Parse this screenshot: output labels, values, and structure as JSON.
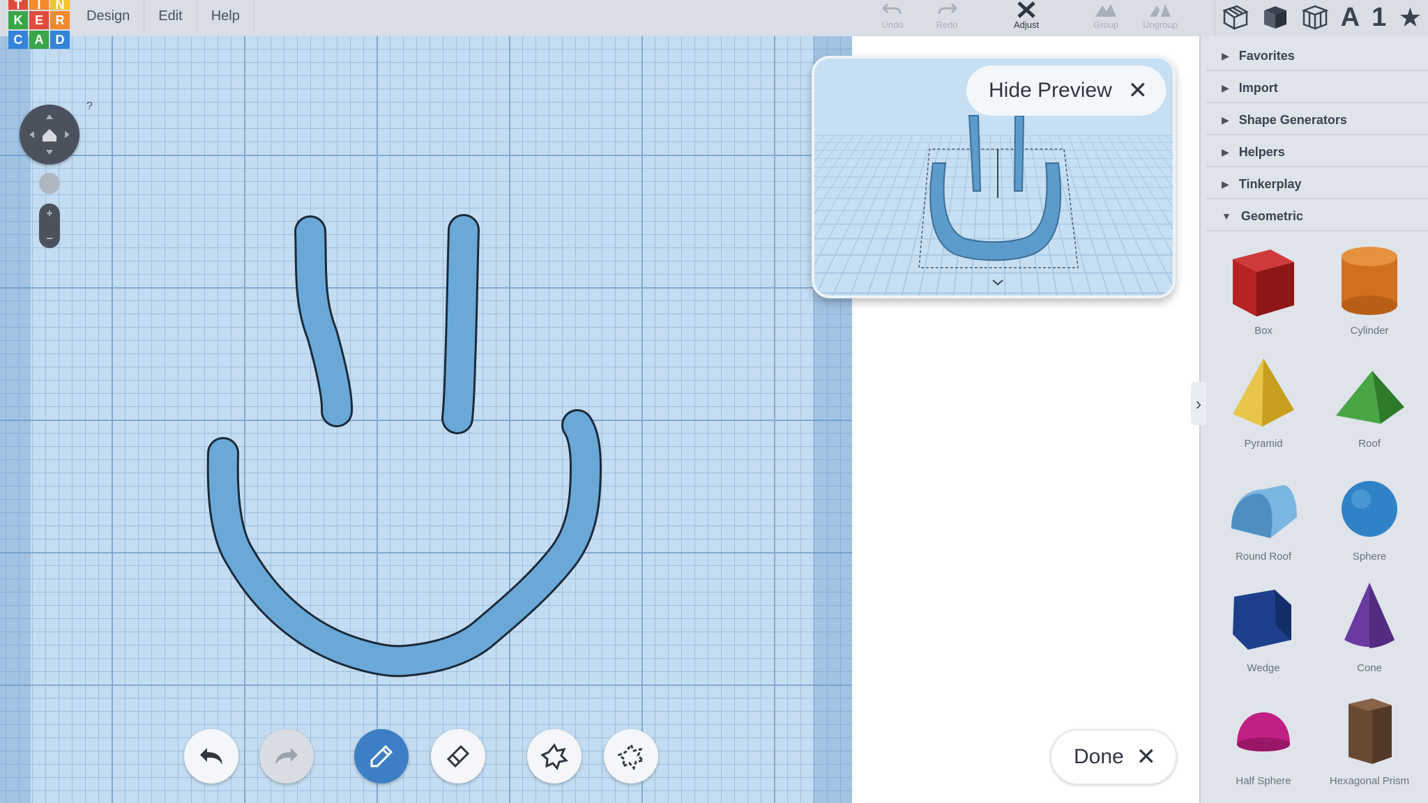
{
  "app": {
    "logo_letters": [
      "T",
      "I",
      "N",
      "K",
      "E",
      "R",
      "C",
      "A",
      "D"
    ],
    "logo_colors": [
      "#e14b3b",
      "#f28a2e",
      "#f5c325",
      "#3aa64a",
      "#e14b3b",
      "#f28a2e",
      "#3584d8",
      "#3aa64a",
      "#3584d8"
    ]
  },
  "menu": {
    "items": [
      {
        "label": "Design"
      },
      {
        "label": "Edit"
      },
      {
        "label": "Help"
      }
    ]
  },
  "toolbar": {
    "undo_label": "Undo",
    "redo_label": "Redo",
    "adjust_label": "Adjust",
    "group_label": "Group",
    "ungroup_label": "Ungroup"
  },
  "view_icons": [
    "grid-view-icon",
    "box-view-icon",
    "wireframe-view-icon",
    "text-icon",
    "number-icon",
    "star-icon"
  ],
  "view_text": {
    "text": "A",
    "number": "1",
    "star": "★"
  },
  "preview": {
    "hide_label": "Hide Preview",
    "close_glyph": "✕"
  },
  "done": {
    "label": "Done",
    "close_glyph": "✕"
  },
  "nav": {
    "help_glyph": "?"
  },
  "panel": {
    "toggle_glyph": "›",
    "categories": [
      {
        "label": "Favorites",
        "expanded": false
      },
      {
        "label": "Import",
        "expanded": false
      },
      {
        "label": "Shape Generators",
        "expanded": false
      },
      {
        "label": "Helpers",
        "expanded": false
      },
      {
        "label": "Tinkerplay",
        "expanded": false
      },
      {
        "label": "Geometric",
        "expanded": true
      }
    ],
    "shapes": [
      {
        "label": "Box",
        "color": "#c42424"
      },
      {
        "label": "Cylinder",
        "color": "#d9772a"
      },
      {
        "label": "Pyramid",
        "color": "#e6c33a"
      },
      {
        "label": "Roof",
        "color": "#3f9a3a"
      },
      {
        "label": "Round Roof",
        "color": "#5ea4d6"
      },
      {
        "label": "Sphere",
        "color": "#2f82c6"
      },
      {
        "label": "Wedge",
        "color": "#1e3f8c"
      },
      {
        "label": "Cone",
        "color": "#6a3aa0"
      },
      {
        "label": "Half Sphere",
        "color": "#c21f84"
      },
      {
        "label": "Hexagonal Prism",
        "color": "#6b4a34"
      }
    ]
  },
  "colors": {
    "stroke_fill": "#6aa8d8",
    "accent": "#3d7fc5"
  }
}
